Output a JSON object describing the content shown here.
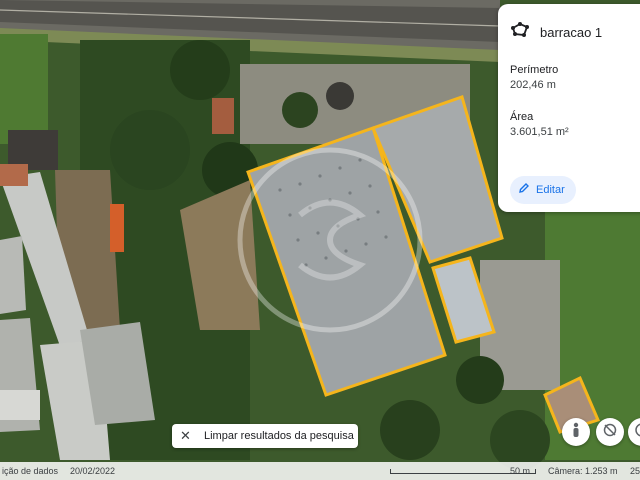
{
  "info_panel": {
    "title": "barracao 1",
    "perimeter_label": "Perímetro",
    "perimeter_value": "202,46 m",
    "area_label": "Área",
    "area_value": "3.601,51 m²",
    "edit_label": "Editar"
  },
  "clear_chip": {
    "label": "Limpar resultados da pesquisa"
  },
  "bottom_bar": {
    "imagery_label": "ição de dados",
    "imagery_date": "20/02/2022",
    "scale_label": "50 m",
    "camera_label": "Câmera: 1.253 m",
    "trailing": "25"
  },
  "colors": {
    "outline": "#f5b51c",
    "accent": "#1a73e8"
  },
  "icons": {
    "polygon": "polygon-icon",
    "edit": "pencil-icon",
    "clear": "close-icon",
    "person": "pegman-icon",
    "rotate": "rotate-icon",
    "globe": "globe-icon"
  }
}
